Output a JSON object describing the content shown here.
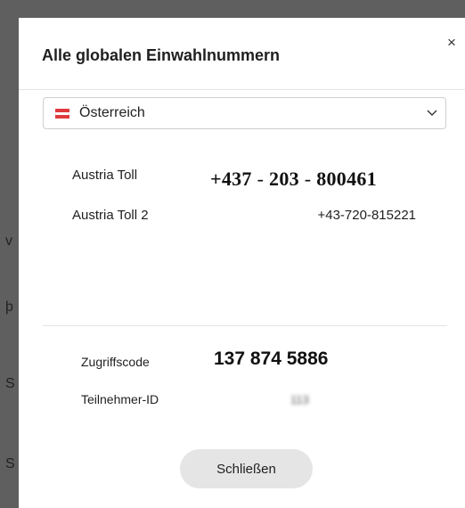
{
  "background": {
    "glyphs": [
      "v",
      "þ",
      "S",
      "S"
    ]
  },
  "dialog": {
    "title": "Alle globalen Einwahlnummern",
    "close_icon": "close-icon",
    "close_glyph": "×",
    "country_select": {
      "selected": "Österreich",
      "flag_icon": "austria-flag-icon",
      "chevron_icon": "chevron-down-icon"
    },
    "numbers": [
      {
        "label": "Austria Toll",
        "parts": [
          "+437",
          "-",
          "203",
          "-",
          "800461"
        ]
      },
      {
        "label": "Austria Toll 2",
        "number": "+43-720-815221"
      }
    ],
    "access_code": {
      "label": "Zugriffscode",
      "value": "137 874 5886"
    },
    "participant_id": {
      "label": "Teilnehmer-ID",
      "value": "113"
    },
    "close_button_label": "Schließen"
  },
  "colors": {
    "flag_red": "#e03a3e",
    "flag_white": "#ffffff",
    "backdrop": "#5f5f5f"
  }
}
